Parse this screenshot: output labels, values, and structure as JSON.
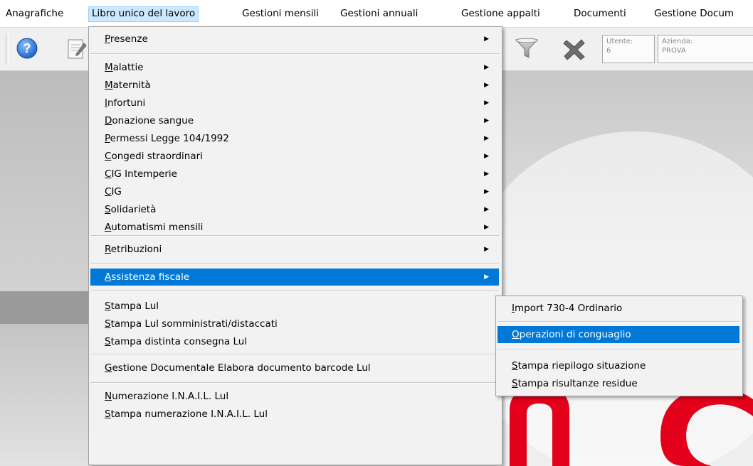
{
  "menubar": {
    "items": [
      "Anagrafiche",
      "Libro unico del lavoro",
      "Gestioni mensili",
      "Gestioni annuali",
      "Gestione appalti",
      "Documenti",
      "Gestione Docum"
    ],
    "active_index": 1
  },
  "toolbar": {
    "buttons": [
      "help-icon",
      "edit-document-icon",
      "filter-icon",
      "delete-x-icon"
    ],
    "utente": {
      "label": "Utente:",
      "value": "6"
    },
    "azienda": {
      "label": "Azienda:",
      "value": "PROVA"
    }
  },
  "main_menu": {
    "items": [
      {
        "mn": "P",
        "rest": "resenze",
        "submenu": true
      },
      {
        "mn": "M",
        "rest": "alattie",
        "submenu": true
      },
      {
        "mn": "M",
        "rest": "aternità",
        "submenu": true
      },
      {
        "mn": "I",
        "rest": "nfortuni",
        "submenu": true
      },
      {
        "mn": "D",
        "rest": "onazione sangue",
        "submenu": true
      },
      {
        "mn": "P",
        "rest": "ermessi Legge 104/1992",
        "submenu": true
      },
      {
        "mn": "C",
        "rest": "ongedi straordinari",
        "submenu": true
      },
      {
        "mn": "C",
        "rest": "IG Intemperie",
        "submenu": true
      },
      {
        "mn": "C",
        "rest": "IG",
        "submenu": true
      },
      {
        "mn": "S",
        "rest": "olidarietà",
        "submenu": true
      },
      {
        "mn": "A",
        "rest": "utomatismi mensili",
        "submenu": true
      },
      {
        "mn": "R",
        "rest": "etribuzioni",
        "submenu": true
      },
      {
        "mn": "A",
        "rest": "ssistenza fiscale",
        "submenu": true,
        "highlighted": true
      },
      {
        "mn": "S",
        "rest": "tampa Lul",
        "submenu": false
      },
      {
        "mn": "S",
        "rest": "tampa Lul somministrati/distaccati",
        "submenu": false
      },
      {
        "mn": "S",
        "rest": "tampa distinta consegna Lul",
        "submenu": false
      },
      {
        "mn": "G",
        "rest": "estione Documentale Elabora documento barcode Lul",
        "submenu": false
      },
      {
        "mn": "N",
        "rest": "umerazione I.N.A.I.L. Lul",
        "submenu": false
      },
      {
        "mn": "S",
        "rest": "tampa numerazione I.N.A.I.L. Lul",
        "submenu": false
      }
    ]
  },
  "sub_menu": {
    "items": [
      {
        "mn": "I",
        "rest": "mport 730-4 Ordinario"
      },
      {
        "mn": "O",
        "rest": "perazioni di conguaglio",
        "highlighted": true
      },
      {
        "mn": "S",
        "rest": "tampa riepilogo situazione"
      },
      {
        "mn": "S",
        "rest": "tampa risultanze residue"
      }
    ]
  },
  "colors": {
    "highlight": "#0078d7",
    "menubar_active": "#cce8ff",
    "logo_red": "#e2001a",
    "menu_bg": "#f2f2f2"
  }
}
